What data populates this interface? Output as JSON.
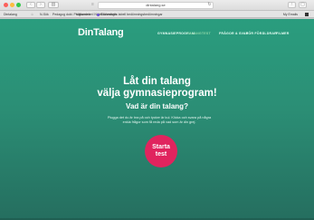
{
  "browser": {
    "url": "dintalang.se",
    "bookmarks": [
      "Dintalang",
      "☆",
      "N-Sök",
      "Pedagog dokt. Programlek",
      "Välkommen! Nätet föreningar",
      "Skolverket's tabell bedömningsbedömningar",
      "My Emails"
    ],
    "nav_back": "‹",
    "nav_forward": "›",
    "sidebar": "▥",
    "reader": "≡",
    "reload": "↻",
    "share": "↑",
    "tabs": "▢"
  },
  "site": {
    "logo": "DinTalang",
    "menu": [
      "GYMNASIEPROGRAM",
      "TALANGTEST",
      "FRÅGOR & SVAR",
      "FÖR FÖRÄLDRAR",
      "FILMER"
    ],
    "active_color": "#8dd7a8"
  },
  "hero": {
    "headline_line1": "Låt din talang",
    "headline_line2": "välja gymnasieprogram!",
    "subheading": "Vad är din talang?",
    "description": "Plugga det du är bra på och tycker är kul. Klicka och svara på några enkla frågor som få reda på vad som är din grej.",
    "cta_line1": "Starta",
    "cta_line2": "test",
    "cta_color": "#e0245e"
  },
  "colors": {
    "page_top": "#2a9d7e",
    "page_bottom": "#256e5f"
  }
}
